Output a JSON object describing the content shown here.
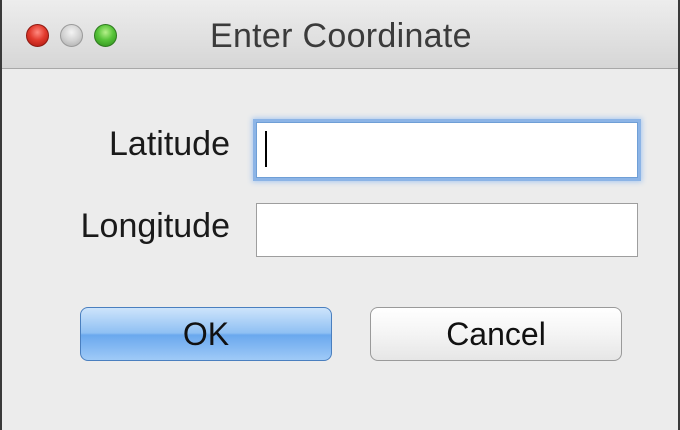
{
  "window": {
    "title": "Enter Coordinate",
    "controls": {
      "close_icon": "close-icon",
      "minimize_icon": "minimize-icon",
      "zoom_icon": "zoom-icon"
    }
  },
  "form": {
    "latitude": {
      "label": "Latitude",
      "value": "",
      "focused": true
    },
    "longitude": {
      "label": "Longitude",
      "value": ""
    }
  },
  "buttons": {
    "ok_label": "OK",
    "cancel_label": "Cancel"
  },
  "colors": {
    "close": "#e23b2e",
    "minimize": "#d2d2d2",
    "zoom": "#58c43a",
    "default_button": "#8fc0f3",
    "focus_ring": "#8cb4e6"
  }
}
